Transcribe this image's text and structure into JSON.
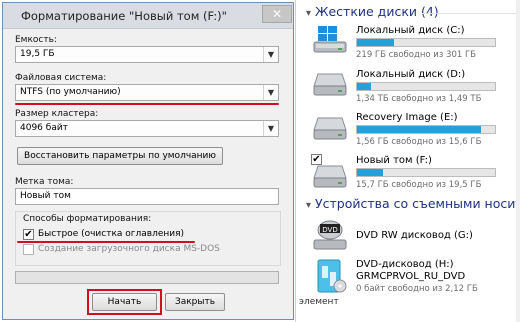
{
  "dialog": {
    "title": "Форматирование \"Новый том (F:)\"",
    "close_glyph": "✕",
    "capacity": {
      "label": "Емкость:",
      "value": "19,5 ГБ"
    },
    "filesystem": {
      "label": "Файловая система:",
      "value": "NTFS (по умолчанию)"
    },
    "cluster": {
      "label": "Размер кластера:",
      "value": "4096 байт"
    },
    "restore_button": "Восстановить параметры по умолчанию",
    "volume_label": {
      "label": "Метка тома:",
      "value": "Новый том"
    },
    "format_options": {
      "label": "Способы форматирования:",
      "quick": {
        "label": "Быстрое (очистка оглавления)",
        "checked": true
      },
      "msdos": {
        "label": "Создание загрузочного диска MS-DOS",
        "checked": false
      }
    },
    "start_button": "Начать",
    "close_button": "Закрыть",
    "accent_red": "#d01020"
  },
  "explorer": {
    "hard_drives": {
      "header": "Жесткие диски (4)",
      "drives": [
        {
          "name": "Локальный диск (C:)",
          "free": "219 ГБ свободно из 301 ГБ",
          "used_fraction": 0.27,
          "icon": "windows-drive-icon"
        },
        {
          "name": "Локальный диск (D:)",
          "free": "1,34 ТБ свободно из 1,49 ТБ",
          "used_fraction": 0.1,
          "icon": "hard-drive-icon"
        },
        {
          "name": "Recovery Image (E:)",
          "free": "1,56 ГБ свободно из 15,6 ГБ",
          "used_fraction": 0.9,
          "icon": "hard-drive-icon"
        },
        {
          "name": "Новый том (F:)",
          "free": "15,7 ГБ свободно из 19,5 ГБ",
          "used_fraction": 0.19,
          "icon": "hard-drive-icon",
          "selected": true
        }
      ]
    },
    "removable": {
      "header": "Устройства со съемными носителями",
      "devices": [
        {
          "name": "DVD RW дисковод (G:)",
          "icon": "dvd-drive-icon"
        },
        {
          "name": "DVD-дисковод (H:)",
          "subname": "GRMCPRVOL_RU_DVD",
          "free": "0 байт свободно из 2,12 ГБ",
          "icon": "dvd-media-icon"
        }
      ]
    },
    "footer": "элемент",
    "bar_color": "#26a0da"
  }
}
